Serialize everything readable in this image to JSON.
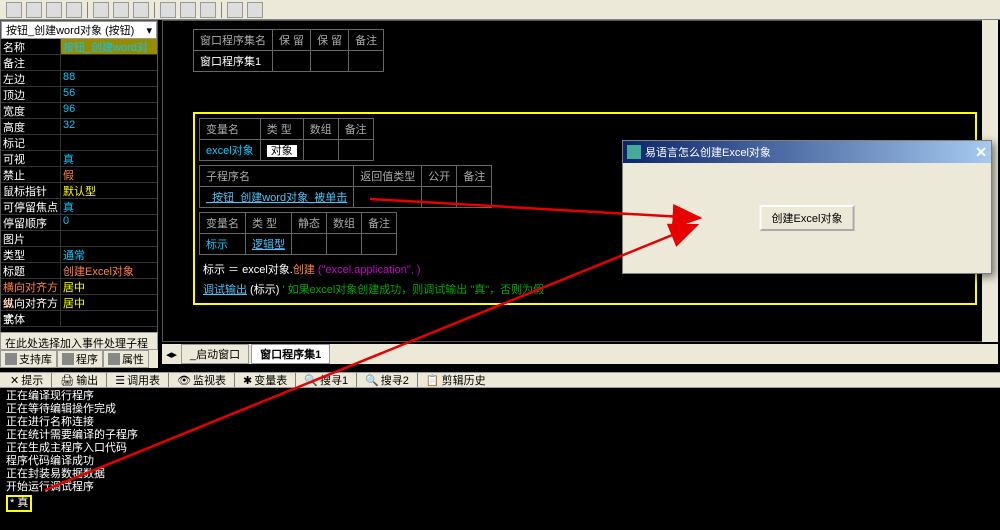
{
  "left": {
    "dropdown": "按钮_创建word对象 (按钮)",
    "props": [
      {
        "l": "名称",
        "v": "按钮_创建word对",
        "c": "#00c8ff",
        "hl": true
      },
      {
        "l": "备注",
        "v": "",
        "c": "#fff"
      },
      {
        "l": "左边",
        "v": "88",
        "c": "#00c8ff"
      },
      {
        "l": "顶边",
        "v": "56",
        "c": "#00c8ff"
      },
      {
        "l": "宽度",
        "v": "96",
        "c": "#00c8ff"
      },
      {
        "l": "高度",
        "v": "32",
        "c": "#00c8ff"
      },
      {
        "l": "标记",
        "v": "",
        "c": "#fff"
      },
      {
        "l": "可视",
        "v": "真",
        "c": "#00c8ff"
      },
      {
        "l": "禁止",
        "v": "假",
        "c": "#ff8040"
      },
      {
        "l": "鼠标指针",
        "v": "默认型",
        "c": "#ffff00"
      },
      {
        "l": "可停留焦点",
        "v": "真",
        "c": "#00c8ff"
      },
      {
        "l": "停留顺序",
        "v": "0",
        "c": "#00c8ff"
      },
      {
        "l": "图片",
        "v": "",
        "c": "#fff"
      },
      {
        "l": "类型",
        "v": "通常",
        "c": "#00c8ff"
      },
      {
        "l": "标题",
        "v": "创建Excel对象",
        "c": "#ff8040"
      },
      {
        "l": "横向对齐方式",
        "v": "居中",
        "c": "#ffff00",
        "lc": "#ff8040"
      },
      {
        "l": "纵向对齐方式",
        "v": "居中",
        "c": "#ffff00"
      },
      {
        "l": "字体",
        "v": "",
        "c": "#fff"
      }
    ]
  },
  "left_bottom": {
    "caption": "在此处选择加入事件处理子程序",
    "tabs": [
      "支持库",
      "程序",
      "属性"
    ]
  },
  "code": {
    "table1": {
      "headers": [
        "窗口程序集名",
        "保  留",
        "保  留",
        "备注"
      ],
      "row": "窗口程序集1"
    },
    "table_var": {
      "headers": [
        "变量名",
        "类  型",
        "数组",
        "备注"
      ],
      "rowvar": "excel对象",
      "rowtype": "对象"
    },
    "table_sub": {
      "headers": [
        "子程序名",
        "返回值类型",
        "公开",
        "备注"
      ],
      "row": "_按钮_创建word对象_被单击"
    },
    "table_local": {
      "headers": [
        "变量名",
        "类  型",
        "静态",
        "数组",
        "备注"
      ],
      "rowvar": "标示",
      "rowtype": "逻辑型"
    },
    "line1_pre": "标示 ＝ excel对象.",
    "line1_call": "创建",
    "line1_paren_open": " (",
    "line1_str": "\"excel.application\"",
    "line1_paren_close": ", )",
    "line2_call": "调试输出",
    "line2_args": " (标示)  ",
    "line2_comment": "' 如果excel对象创建成功，则调试输出 \"真\"，否则为假"
  },
  "main_tabs": [
    "_启动窗口",
    "窗口程序集1"
  ],
  "output_tabs": [
    "提示",
    "输出",
    "调用表",
    "监视表",
    "变量表",
    "搜寻1",
    "搜寻2",
    "剪辑历史"
  ],
  "output_lines": [
    "正在编译现行程序",
    "正在等待编辑操作完成",
    "正在进行名称连接",
    "正在统计需要编译的子程序",
    "正在生成主程序入口代码",
    "程序代码编译成功",
    "正在封装易数据数据",
    "开始运行调试程序"
  ],
  "output_result": "* 真",
  "dialog": {
    "title": "易语言怎么创建Excel对象",
    "button": "创建Excel对象",
    "close": "✕"
  }
}
